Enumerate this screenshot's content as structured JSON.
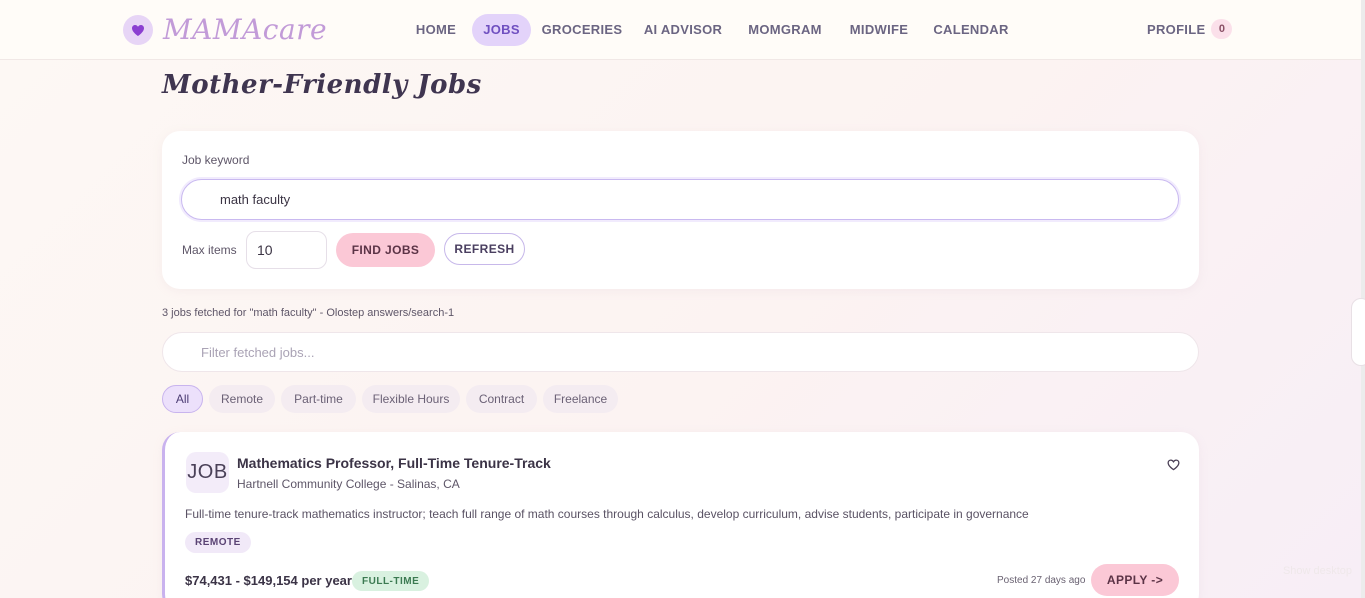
{
  "nav": {
    "brand": "MAMAcare",
    "items": [
      "HOME",
      "JOBS",
      "GROCERIES",
      "AI ADVISOR",
      "MOMGRAM",
      "MIDWIFE",
      "CALENDAR"
    ],
    "active": "JOBS",
    "profile_label": "PROFILE",
    "profile_count": "0"
  },
  "page": {
    "title": "Mother-Friendly Jobs"
  },
  "search": {
    "keyword_label": "Job keyword",
    "keyword_value": "math faculty",
    "max_label": "Max items",
    "max_value": "10",
    "find_button": "FIND JOBS",
    "refresh_button": "REFRESH"
  },
  "status": {
    "text": "3 jobs fetched for \"math faculty\" - Olostep answers/search-1",
    "filter_placeholder": "Filter fetched jobs..."
  },
  "chips": [
    "All",
    "Remote",
    "Part-time",
    "Flexible Hours",
    "Contract",
    "Freelance"
  ],
  "job": {
    "logo": "JOB",
    "title": "Mathematics Professor, Full-Time Tenure-Track",
    "company": "Hartnell Community College - Salinas, CA",
    "description": "Full-time tenure-track mathematics instructor; teach full range of math courses through calculus, develop curriculum, advise students, participate in governance",
    "tag": "REMOTE",
    "salary": "$74,431 - $149,154 per year",
    "type": "FULL-TIME",
    "posted": "Posted 27 days ago",
    "apply_button": "APPLY ->"
  },
  "overlay": {
    "show_desktop": "Show desktop"
  },
  "colors": {
    "accent": "#e3d3fa",
    "pink_button": "#fbc8d6",
    "brand": "#c29bd8",
    "fulltime_badge": "#d9f1e0"
  }
}
